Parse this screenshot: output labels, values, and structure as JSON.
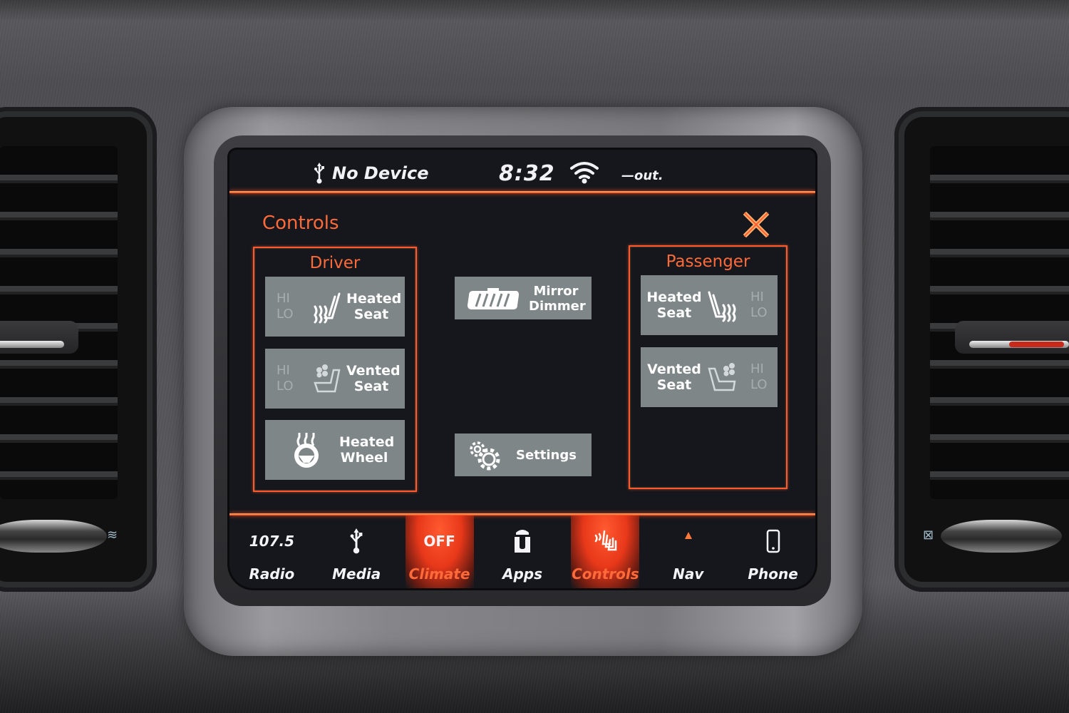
{
  "colors": {
    "accent": "#ff5a2e",
    "tile_bg": "#7f8688",
    "screen_bg": "#15171c",
    "hilo_inactive": "#a5adb0"
  },
  "status_bar": {
    "usb_icon": "usb-icon",
    "device_text": "No Device",
    "clock": "8:32",
    "wifi_icon": "wifi-icon",
    "outside_temp": "—out."
  },
  "controls": {
    "title": "Controls",
    "close_icon": "close-icon",
    "driver": {
      "title": "Driver",
      "tiles": [
        {
          "hi": "HI",
          "lo": "LO",
          "icon": "heated-seat-icon",
          "line1": "Heated",
          "line2": "Seat"
        },
        {
          "hi": "HI",
          "lo": "LO",
          "icon": "vented-seat-icon",
          "line1": "Vented",
          "line2": "Seat"
        },
        {
          "icon": "heated-wheel-icon",
          "line1": "Heated",
          "line2": "Wheel"
        }
      ]
    },
    "center": {
      "mirror": {
        "icon": "mirror-icon",
        "line1": "Mirror",
        "line2": "Dimmer"
      },
      "settings": {
        "icon": "gear-icon",
        "label": "Settings"
      }
    },
    "passenger": {
      "title": "Passenger",
      "tiles": [
        {
          "hi": "HI",
          "lo": "LO",
          "icon": "heated-seat-icon",
          "line1": "Heated",
          "line2": "Seat"
        },
        {
          "hi": "HI",
          "lo": "LO",
          "icon": "vented-seat-icon",
          "line1": "Vented",
          "line2": "Seat"
        }
      ]
    }
  },
  "nav": [
    {
      "top": "107.5",
      "label": "Radio",
      "active": false
    },
    {
      "icon": "usb-icon",
      "label": "Media",
      "active": false
    },
    {
      "top": "OFF",
      "label": "Climate",
      "active": true
    },
    {
      "icon": "apps-icon",
      "label": "Apps",
      "active": false
    },
    {
      "icon": "seat-controls-icon",
      "label": "Controls",
      "active": true
    },
    {
      "icon": "nav-arrow-icon",
      "label": "Nav",
      "active": false
    },
    {
      "icon": "phone-icon",
      "label": "Phone",
      "active": false
    }
  ]
}
